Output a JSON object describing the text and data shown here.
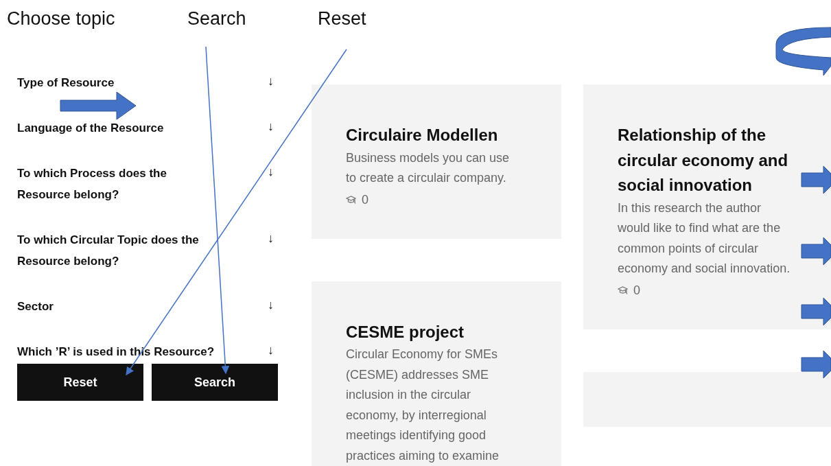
{
  "header": {
    "labels": [
      "Choose topic",
      "Search",
      "Reset"
    ]
  },
  "filters": [
    {
      "label": "Type of Resource",
      "toggle": "↓"
    },
    {
      "label": "Language of the Resource",
      "toggle": "↓"
    },
    {
      "label": "To which Process does the Resource belong?",
      "toggle": "↓"
    },
    {
      "label": "To which Circular Topic does the Resource belong?",
      "toggle": "↓"
    },
    {
      "label": "Sector",
      "toggle": "↓"
    },
    {
      "label": "Which ’R’ is used in this Resource?",
      "toggle": "↓"
    }
  ],
  "buttons": [
    "Reset",
    "Search"
  ],
  "columns": [
    [
      {
        "title": "Circulaire Modellen",
        "description": "Business models you can use to create a circulair company.",
        "count": "0"
      },
      {
        "title": "CESME project",
        "description": "Circular Economy for SMEs (CESME) addresses SME inclusion in the circular economy, by interregional meetings identifying good practices aiming to examine"
      }
    ],
    [
      {
        "title": "Relationship of the circular economy and social innovation",
        "description": "In this research the author would like to find what are the common points of circular economy and social innovation.",
        "count": "0"
      }
    ]
  ]
}
